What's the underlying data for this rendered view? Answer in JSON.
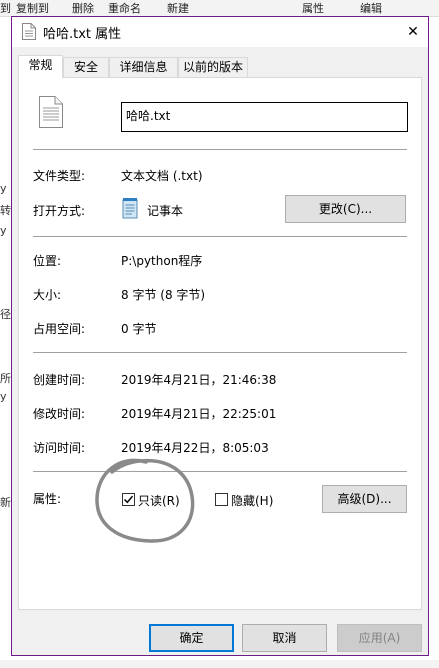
{
  "background": {
    "toolbar_items": [
      "到",
      "复制到",
      "删除",
      "重命名",
      "新建",
      "属性",
      "编辑"
    ],
    "left_letters": [
      "y",
      "转",
      "y",
      "径",
      "所",
      "y",
      "新"
    ]
  },
  "dialog": {
    "title": "哈哈.txt 属性",
    "close_symbol": "✕",
    "tabs": [
      {
        "label": "常规",
        "active": true
      },
      {
        "label": "安全",
        "active": false
      },
      {
        "label": "详细信息",
        "active": false
      },
      {
        "label": "以前的版本",
        "active": false
      }
    ],
    "filename": "哈哈.txt",
    "file_type": {
      "label": "文件类型:",
      "value": "文本文档 (.txt)"
    },
    "open_with": {
      "label": "打开方式:",
      "value": "记事本",
      "button": "更改(C)..."
    },
    "location": {
      "label": "位置:",
      "value": "P:\\python程序"
    },
    "size": {
      "label": "大小:",
      "value": "8 字节 (8 字节)"
    },
    "size_on_disk": {
      "label": "占用空间:",
      "value": "0 字节"
    },
    "created": {
      "label": "创建时间:",
      "value": "2019年4月21日，21:46:38"
    },
    "modified": {
      "label": "修改时间:",
      "value": "2019年4月21日，22:25:01"
    },
    "accessed": {
      "label": "访问时间:",
      "value": "2019年4月22日，8:05:03"
    },
    "attributes": {
      "label": "属性:",
      "readonly": {
        "label": "只读(R)",
        "checked": true
      },
      "hidden": {
        "label": "隐藏(H)",
        "checked": false
      },
      "advanced_button": "高级(D)..."
    },
    "buttons": {
      "ok": "确定",
      "cancel": "取消",
      "apply": "应用(A)"
    }
  },
  "colors": {
    "accent": "#0078d7",
    "window_border": "#6b1e84",
    "annotation": "#8a8a8a"
  },
  "icons": [
    "text-file-icon",
    "notepad-icon",
    "close-icon",
    "checkmark-icon"
  ]
}
